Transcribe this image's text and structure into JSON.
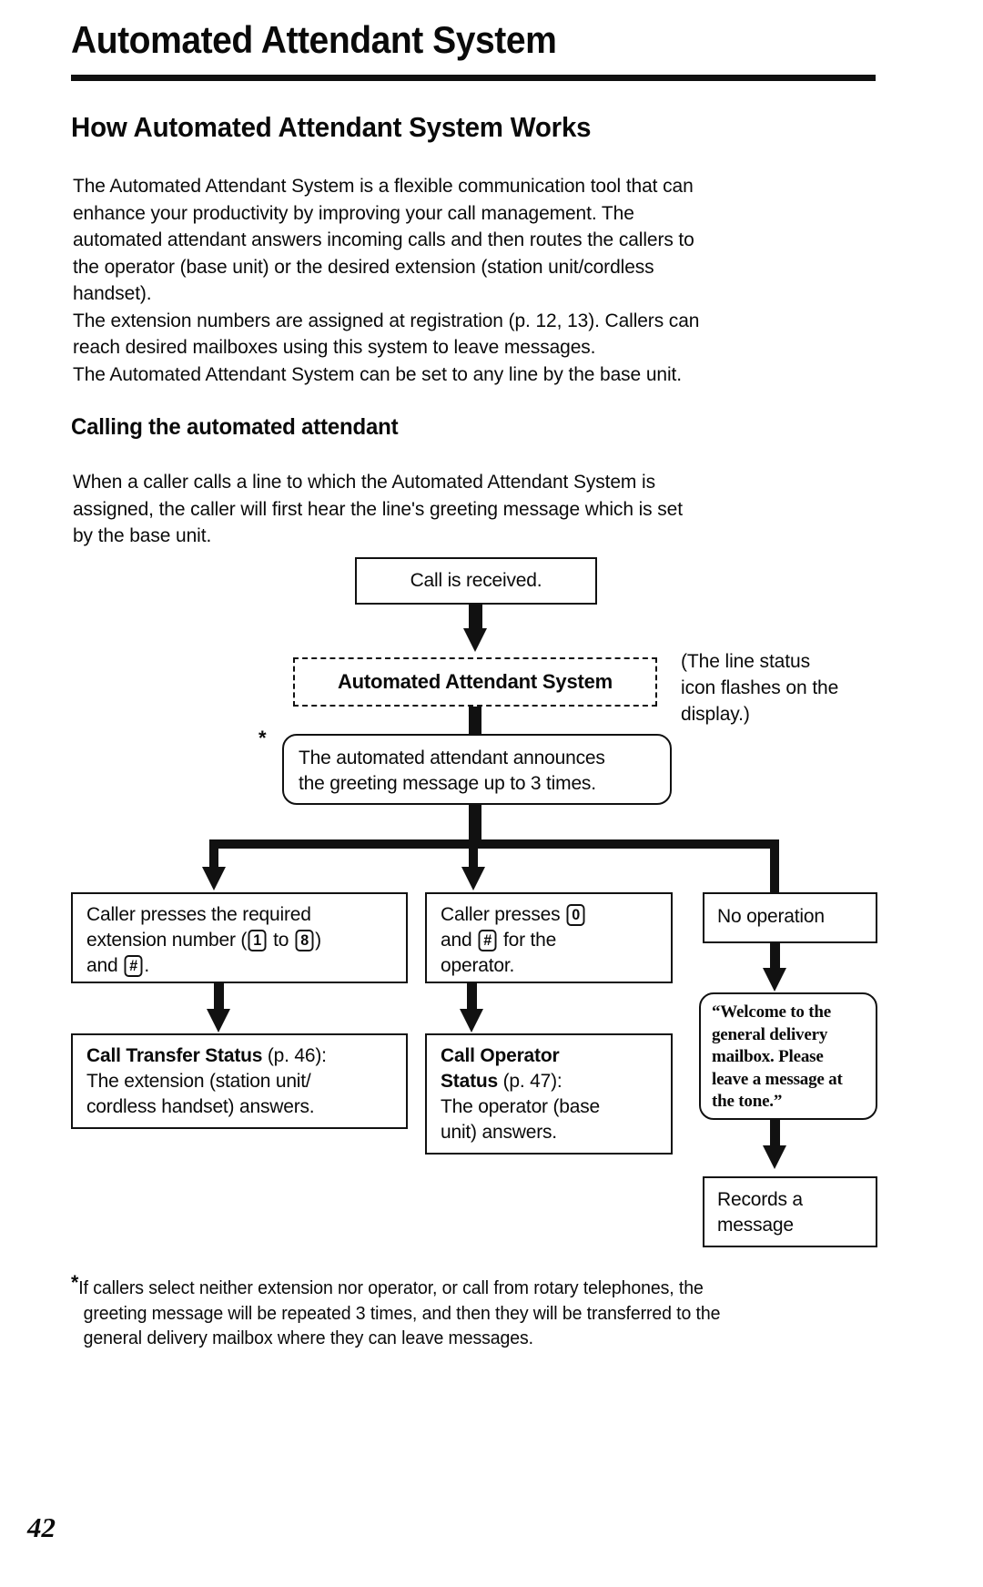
{
  "page": {
    "number": "42",
    "title": "Automated Attendant System"
  },
  "section": {
    "heading": "How Automated Attendant System Works",
    "paragraph1_lines": [
      "The Automated Attendant System is a flexible communication tool that can",
      "enhance your productivity by improving your call management. The",
      "automated attendant answers incoming calls and then routes the callers to",
      "the operator (base unit) or the desired extension (station unit/cordless",
      "handset).",
      "The extension numbers are assigned at registration (p. 12, 13). Callers can",
      "reach desired mailboxes using this system to leave messages.",
      "The Automated Attendant System can be set to any line by the base unit."
    ],
    "subheading": "Calling the automated attendant",
    "paragraph2_lines": [
      "When a caller calls a line to which the Automated Attendant System is",
      "assigned, the caller will first hear the line's greeting message which is set",
      "by the base unit."
    ]
  },
  "flowchart": {
    "box_call_received": "Call is received.",
    "box_automated_attendant_system": "Automated Attendant System",
    "side_note_lines": [
      "(The line status",
      "icon flashes on the",
      "display.)"
    ],
    "asterisk_marker": "*",
    "box_greeting_lines": [
      "The automated attendant announces",
      "the greeting message up to 3 times."
    ],
    "box_extension": {
      "line1": "Caller presses the required",
      "line2_pre": "extension number (",
      "key1": "1",
      "line2_mid": " to ",
      "key2": "8",
      "line2_post": ")",
      "line3_pre": "and ",
      "key3": "#",
      "line3_post": "."
    },
    "box_operator": {
      "line1_pre": "Caller presses ",
      "key1": "0",
      "line2_pre": "and ",
      "key2": "#",
      "line2_post": " for the",
      "line3": "operator."
    },
    "box_no_operation": "No operation",
    "box_call_transfer": {
      "bold": "Call Transfer Status",
      "ref": " (p. 46):",
      "line2": "The extension (station unit/",
      "line3": "cordless handset) answers."
    },
    "box_call_operator": {
      "bold1": "Call Operator",
      "bold2": "Status",
      "ref": " (p. 47):",
      "line3": "The operator (base",
      "line4": "unit) answers."
    },
    "bubble_lines": [
      "“Welcome to the",
      "general delivery",
      "mailbox. Please",
      "leave a message at",
      "the tone.”"
    ],
    "box_records_lines": [
      "Records a",
      "message"
    ]
  },
  "footnote": {
    "star": "*",
    "lines": [
      "If callers select neither extension nor operator, or call from rotary telephones, the",
      "greeting message will be repeated 3 times, and then they will be transferred to the",
      "general delivery mailbox where they can leave messages."
    ]
  }
}
